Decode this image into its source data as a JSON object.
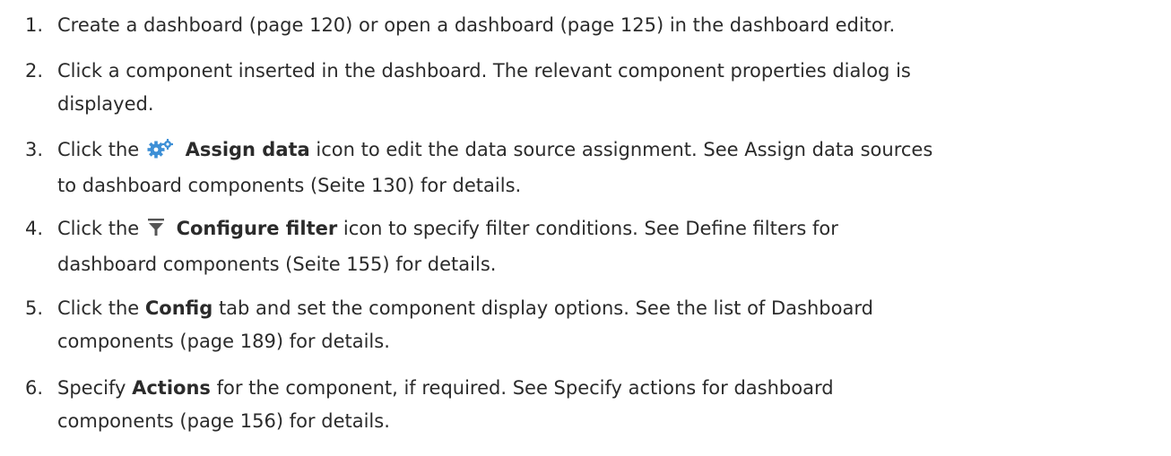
{
  "steps": [
    {
      "number": "1.",
      "text": "Create a dashboard (page 120) or open a dashboard (page 125) in the dashboard editor."
    },
    {
      "number": "2.",
      "line1": "Click a component inserted in the dashboard. The relevant component properties dialog is",
      "line2": "displayed."
    },
    {
      "number": "3.",
      "pre": "Click the",
      "icon": "gears-icon",
      "bold": "Assign data",
      "post": "icon to edit the data source assignment. See Assign data sources",
      "line2": "to dashboard components (Seite 130) for details."
    },
    {
      "number": "4.",
      "pre": "Click the",
      "icon": "filter-icon",
      "bold": "Configure filter",
      "post": "icon to specify filter conditions. See Define filters for",
      "line2": "dashboard components (Seite 155) for details."
    },
    {
      "number": "5.",
      "pre": "Click the",
      "bold": "Config",
      "post": "tab and set the component display options. See the list of Dashboard",
      "line2": "components (page 189) for details."
    },
    {
      "number": "6.",
      "pre": "Specify",
      "bold": "Actions",
      "post": "for the component, if required. See Specify actions for dashboard",
      "line2": "components (page 156) for details."
    }
  ],
  "colors": {
    "text": "#2b2b2b",
    "gear_icon": "#3d8fd6",
    "filter_icon": "#555555"
  }
}
